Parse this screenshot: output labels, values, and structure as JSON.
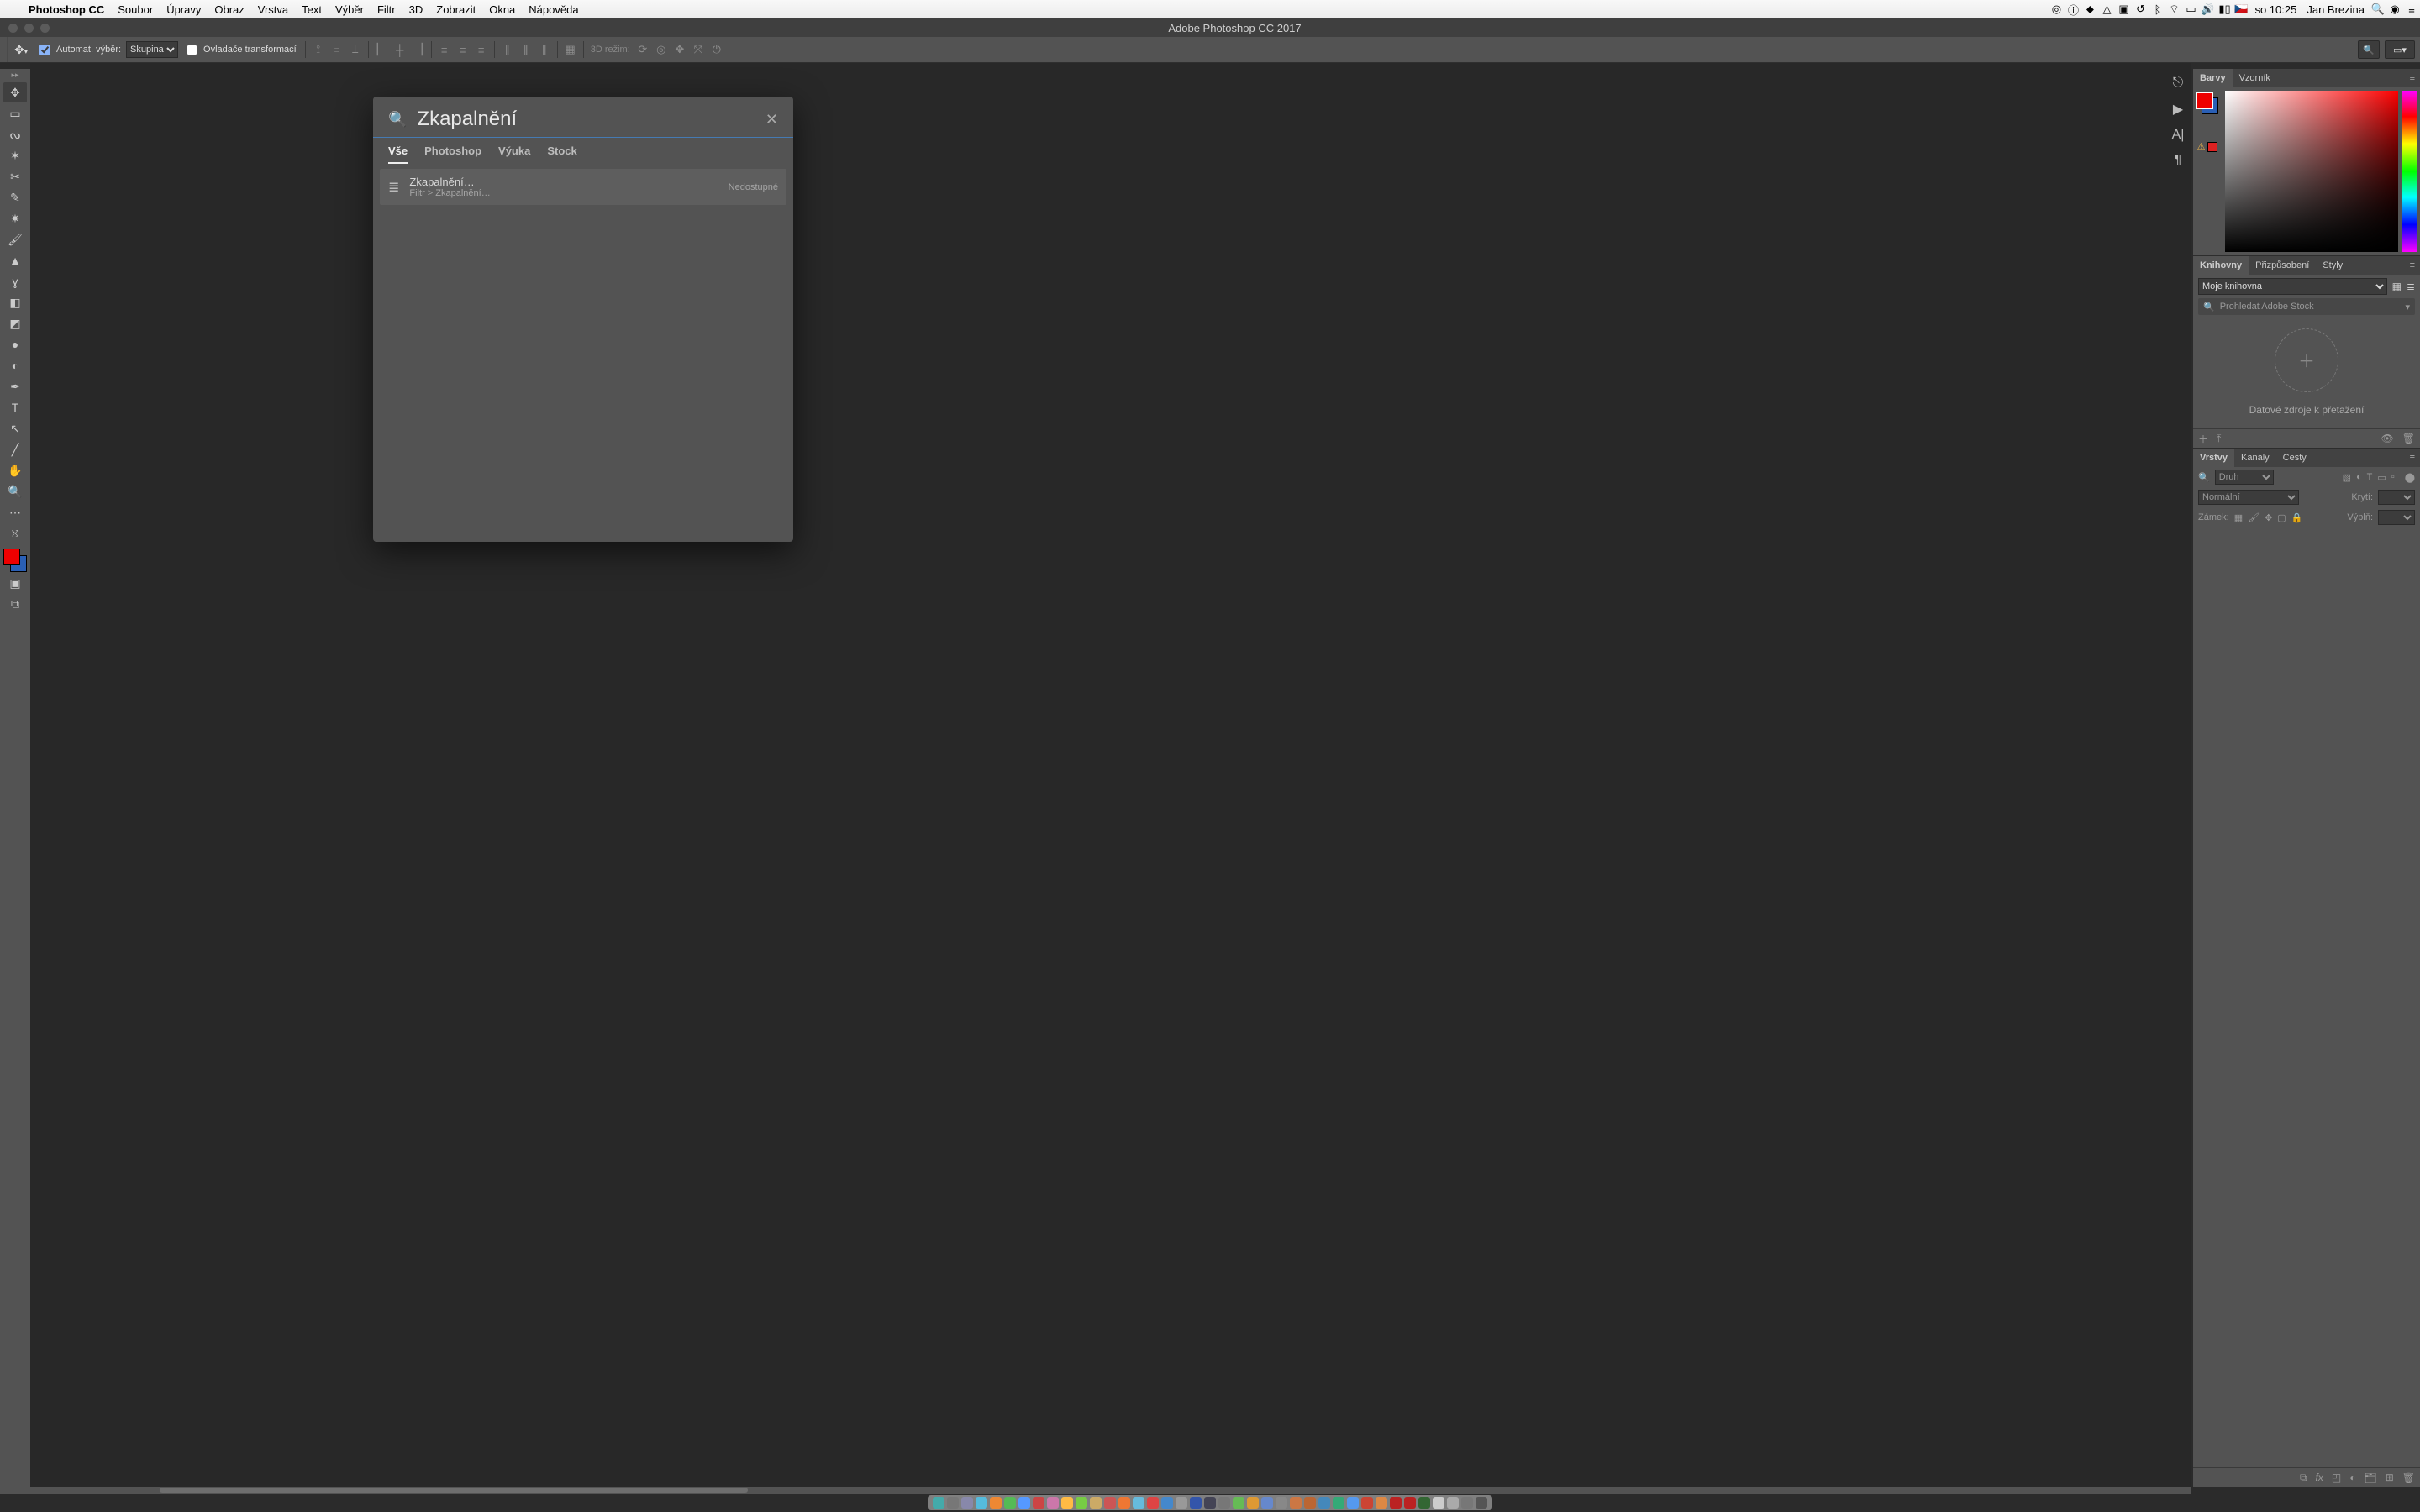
{
  "menubar": {
    "app": "Photoshop CC",
    "items": [
      "Soubor",
      "Úpravy",
      "Obraz",
      "Vrstva",
      "Text",
      "Výběr",
      "Filtr",
      "3D",
      "Zobrazit",
      "Okna",
      "Nápověda"
    ],
    "clock": "so 10:25",
    "user": "Jan Brezina",
    "flag": "🇨🇿"
  },
  "window": {
    "title": "Adobe Photoshop CC 2017"
  },
  "optionsbar": {
    "auto_select_label": "Automat. výběr:",
    "auto_select_value": "Skupina",
    "transform_label": "Ovladače transformací",
    "mode3d_label": "3D režim:"
  },
  "search_dialog": {
    "query": "Zkapalnění",
    "tabs": [
      "Vše",
      "Photoshop",
      "Výuka",
      "Stock"
    ],
    "result_title": "Zkapalnění…",
    "result_path": "Filtr > Zkapalnění…",
    "result_status": "Nedostupné"
  },
  "panels": {
    "color_tabs": [
      "Barvy",
      "Vzorník"
    ],
    "lib_tabs": [
      "Knihovny",
      "Přizpůsobení",
      "Styly"
    ],
    "lib_select": "Moje knihovna",
    "lib_search_placeholder": "Prohledat Adobe Stock",
    "lib_drop_text": "Datové zdroje k přetažení",
    "layer_tabs": [
      "Vrstvy",
      "Kanály",
      "Cesty"
    ],
    "layer_kind": "Druh",
    "layer_blend": "Normální",
    "layer_opacity": "Krytí:",
    "layer_lock": "Zámek:",
    "layer_fill": "Výplň:"
  },
  "dock_colors": [
    "#4aa",
    "#777",
    "#88a",
    "#5bd",
    "#e83",
    "#5b5",
    "#59f",
    "#c44",
    "#c7a",
    "#fb4",
    "#7c4",
    "#ca6",
    "#c55",
    "#e73",
    "#6bd",
    "#d44",
    "#48c",
    "#999",
    "#35a",
    "#445",
    "#777",
    "#6b5",
    "#d93",
    "#68c",
    "#888",
    "#c74",
    "#b63",
    "#48b",
    "#3a7",
    "#59e",
    "#c43",
    "#d84",
    "#b22",
    "#b22",
    "#363",
    "#ccc",
    "#aaa",
    "#777",
    "#555"
  ]
}
